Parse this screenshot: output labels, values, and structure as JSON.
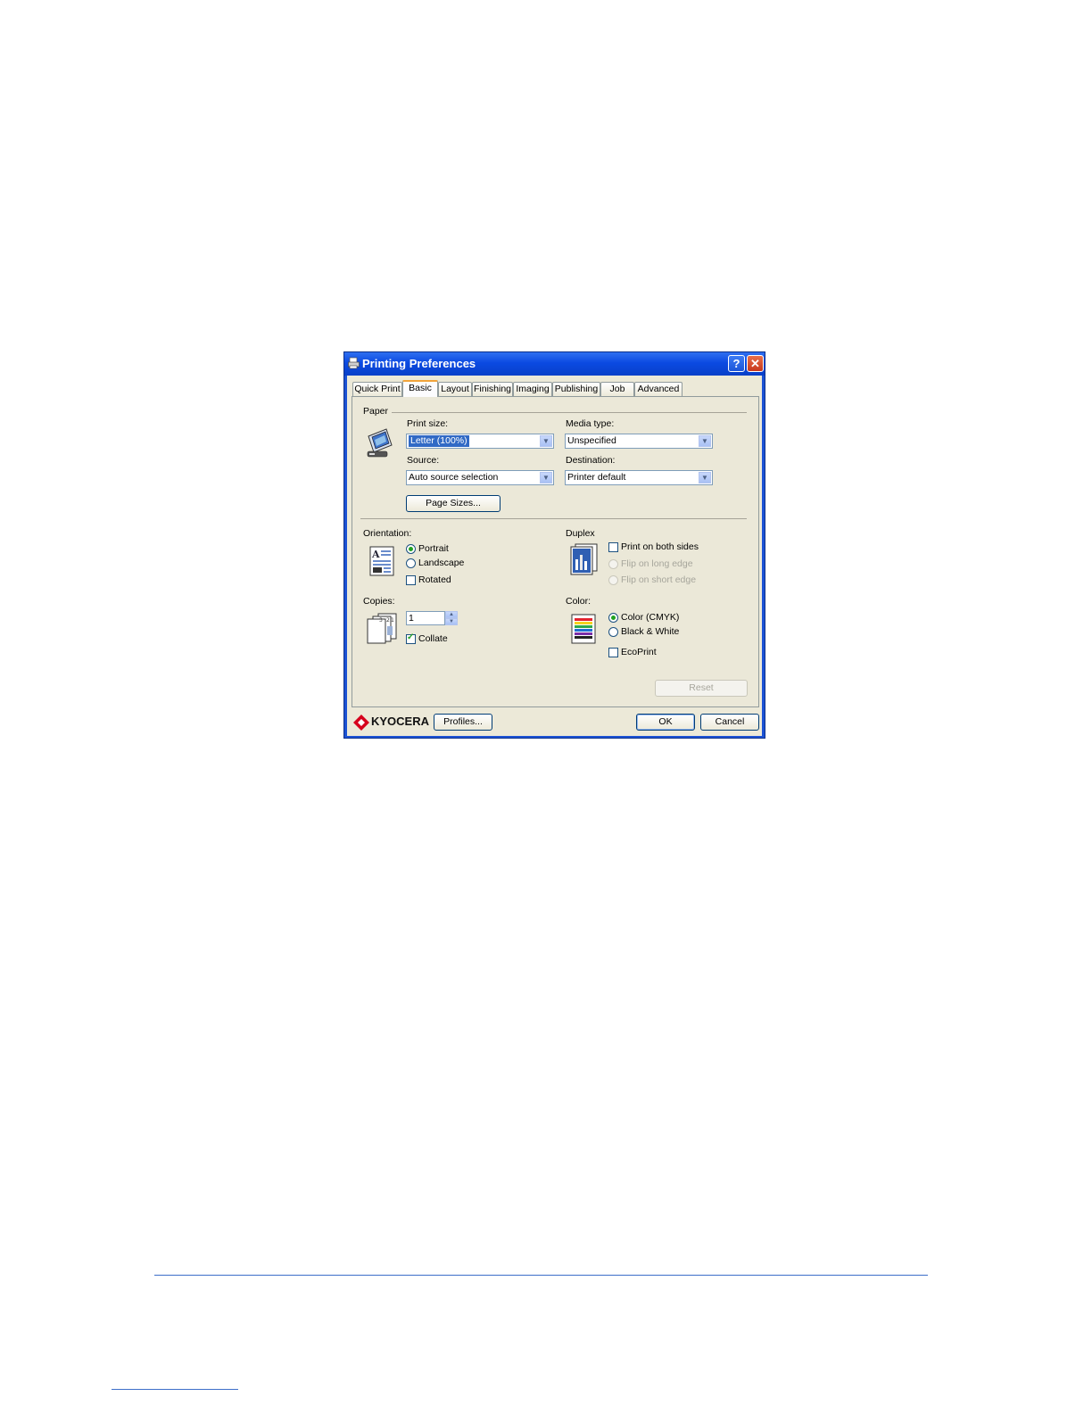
{
  "dialog": {
    "title": "Printing Preferences",
    "help_glyph": "?",
    "close_glyph": "✕"
  },
  "tabs": [
    {
      "label": "Quick Print",
      "active": false
    },
    {
      "label": "Basic",
      "active": true
    },
    {
      "label": "Layout",
      "active": false
    },
    {
      "label": "Finishing",
      "active": false
    },
    {
      "label": "Imaging",
      "active": false
    },
    {
      "label": "Publishing",
      "active": false
    },
    {
      "label": "Job",
      "active": false
    },
    {
      "label": "Advanced",
      "active": false
    }
  ],
  "paper": {
    "group_label": "Paper",
    "print_size_label": "Print size:",
    "print_size_value": "Letter (100%)",
    "media_type_label": "Media type:",
    "media_type_value": "Unspecified",
    "source_label": "Source:",
    "source_value": "Auto source selection",
    "destination_label": "Destination:",
    "destination_value": "Printer default",
    "page_sizes_button": "Page Sizes..."
  },
  "orientation": {
    "label": "Orientation:",
    "options": [
      {
        "label": "Portrait",
        "selected": true
      },
      {
        "label": "Landscape",
        "selected": false
      }
    ],
    "rotated_label": "Rotated",
    "rotated_checked": false
  },
  "duplex": {
    "label": "Duplex",
    "print_both_sides_label": "Print on both sides",
    "print_both_sides_checked": false,
    "flip_long_label": "Flip on long edge",
    "flip_short_label": "Flip on short edge"
  },
  "copies": {
    "label": "Copies:",
    "value": "1",
    "collate_label": "Collate",
    "collate_checked": true
  },
  "color": {
    "label": "Color:",
    "options": [
      {
        "label": "Color (CMYK)",
        "selected": true
      },
      {
        "label": "Black & White",
        "selected": false
      }
    ],
    "ecoprint_label": "EcoPrint",
    "ecoprint_checked": false
  },
  "footer": {
    "reset_button": "Reset",
    "brand": "KYOCERA",
    "profiles_button": "Profiles...",
    "ok_button": "OK",
    "cancel_button": "Cancel"
  },
  "colors": {
    "title_bar": "#0b4ae2",
    "dialog_face": "#ece9d8",
    "selection": "#316ac5",
    "brand_red": "#d6001c",
    "rule": "#3d6fc9"
  }
}
